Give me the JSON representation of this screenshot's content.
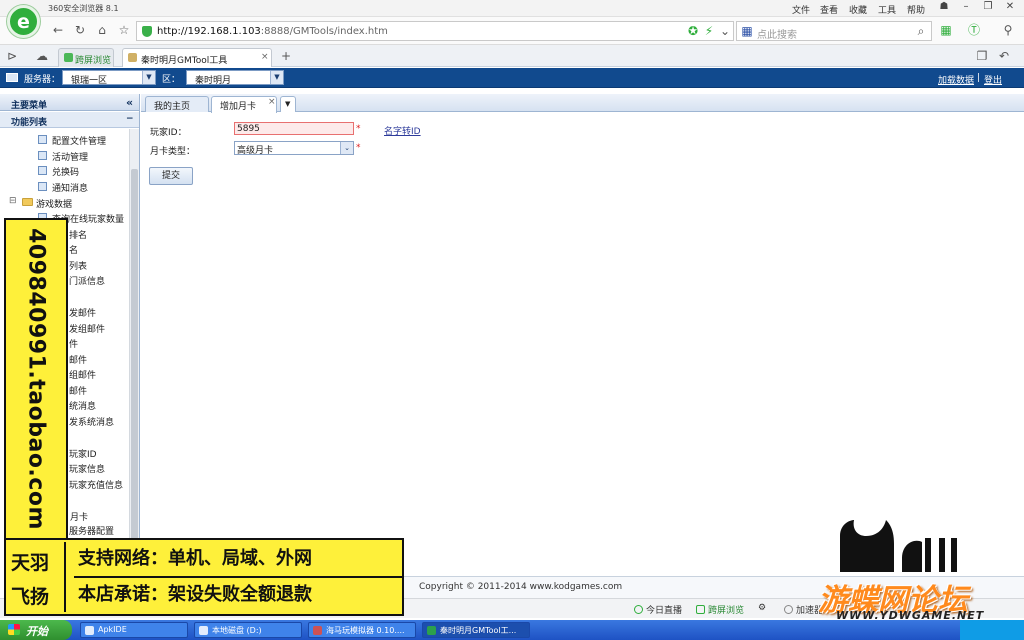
{
  "browser": {
    "title": "360安全浏览器 8.1",
    "menu": [
      "文件",
      "查看",
      "收藏",
      "工具",
      "帮助"
    ],
    "address": {
      "host": "http://192.168.1.103",
      "path": ":8888/GMTools/index.htm"
    },
    "search_placeholder": "点此搜索",
    "tabs": [
      {
        "label": "跨屏浏览",
        "active": false
      },
      {
        "label": "秦时明月GMTool工具",
        "active": true
      }
    ]
  },
  "app_header": {
    "server_label": "服务器：",
    "server_value": "银瑞一区",
    "zone_label": "区：",
    "zone_value": "秦时明月",
    "links": [
      "加载数据",
      "登出"
    ],
    "link_sep": "|"
  },
  "sidebar": {
    "title": "主要菜单",
    "collapse_icon": "«",
    "section": "功能列表",
    "section_toggle": "−",
    "items": [
      {
        "label": "配置文件管理",
        "type": "page"
      },
      {
        "label": "活动管理",
        "type": "page"
      },
      {
        "label": "兑换码",
        "type": "page"
      },
      {
        "label": "通知消息",
        "type": "page"
      },
      {
        "label": "游戏数据",
        "type": "folder"
      },
      {
        "label": "查询在线玩家数量",
        "type": "page"
      },
      {
        "label": "排名",
        "type": "partial"
      },
      {
        "label": "名",
        "type": "partial"
      },
      {
        "label": "列表",
        "type": "partial"
      },
      {
        "label": "门派信息",
        "type": "partial"
      },
      {
        "label": "发邮件",
        "type": "partial"
      },
      {
        "label": "发组邮件",
        "type": "partial"
      },
      {
        "label": "件",
        "type": "partial"
      },
      {
        "label": "邮件",
        "type": "partial"
      },
      {
        "label": "组邮件",
        "type": "partial"
      },
      {
        "label": "邮件",
        "type": "partial"
      },
      {
        "label": "统消息",
        "type": "partial"
      },
      {
        "label": "发系统消息",
        "type": "partial"
      },
      {
        "label": "玩家ID",
        "type": "partial"
      },
      {
        "label": "玩家信息",
        "type": "partial"
      },
      {
        "label": "玩家充值信息",
        "type": "partial"
      },
      {
        "label": "月卡",
        "type": "partial"
      },
      {
        "label": "服务器配置",
        "type": "partial"
      }
    ]
  },
  "content": {
    "tabs": [
      {
        "label": "我的主页",
        "active": false
      },
      {
        "label": "增加月卡",
        "active": true,
        "close": "×"
      }
    ],
    "form": {
      "player_id_label": "玩家ID：",
      "player_id_value": "5895",
      "required_mark": "*",
      "name_link": "名字转ID",
      "card_type_label": "月卡类型：",
      "card_type_value": "高级月卡",
      "submit_label": "提交"
    },
    "copyright": "Copyright © 2011-2014 www.kodgames.com"
  },
  "statusbar": [
    "今日直播",
    "跨屏浏览",
    "加速器"
  ],
  "taskbar": {
    "start": "开始",
    "tasks": [
      {
        "label": "ApkIDE",
        "active": false
      },
      {
        "label": "本地磁盘 (D:)",
        "active": false
      },
      {
        "label": "海马玩模拟器 0.10....",
        "active": false
      },
      {
        "label": "秦时明月GMTool工...",
        "active": true
      }
    ]
  },
  "overlay": {
    "vertical_text": "409840991.taobao.com",
    "brand": [
      "天羽",
      "飞扬"
    ],
    "lines": [
      "支持网络：单机、局域、外网",
      "本店承诺：架设失败全额退款"
    ]
  },
  "watermark": {
    "title": "游蝶网论坛",
    "url": "WWW.YDWGAME.NET"
  },
  "colors": {
    "header_blue": "#114a8e",
    "accent_green": "#2fae3c",
    "overlay_yellow": "#fef03a",
    "watermark_orange": "#ff8a1d"
  }
}
